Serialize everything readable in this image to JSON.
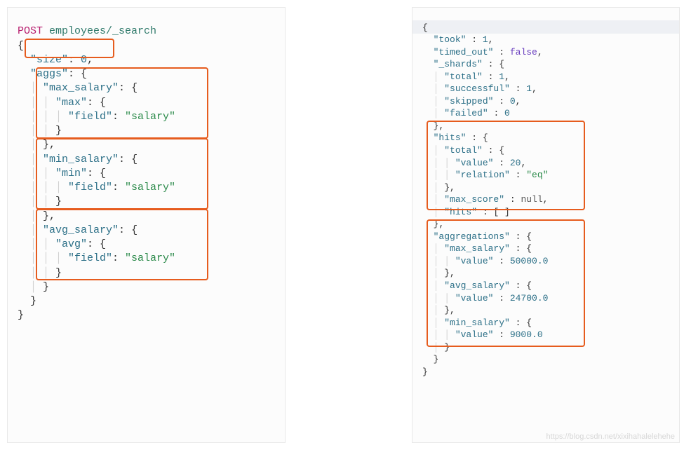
{
  "request": {
    "method": "POST",
    "path": "employees/_search",
    "size_key": "\"size\"",
    "size_val": "0",
    "aggs_key": "\"aggs\"",
    "max_salary_key": "\"max_salary\"",
    "max_key": "\"max\"",
    "min_salary_key": "\"min_salary\"",
    "min_key": "\"min\"",
    "avg_salary_key": "\"avg_salary\"",
    "avg_key": "\"avg\"",
    "field_key": "\"field\"",
    "field_val": "\"salary\""
  },
  "response": {
    "took_key": "\"took\"",
    "took_val": "1",
    "timed_out_key": "\"timed_out\"",
    "timed_out_val": "false",
    "shards_key": "\"_shards\"",
    "total_key": "\"total\"",
    "shards_total_val": "1",
    "successful_key": "\"successful\"",
    "successful_val": "1",
    "skipped_key": "\"skipped\"",
    "skipped_val": "0",
    "failed_key": "\"failed\"",
    "failed_val": "0",
    "hits_key": "\"hits\"",
    "hits_total_key": "\"total\"",
    "value_key": "\"value\"",
    "hits_total_value": "20",
    "relation_key": "\"relation\"",
    "relation_val": "\"eq\"",
    "max_score_key": "\"max_score\"",
    "max_score_val": "null",
    "hits_arr_key": "\"hits\"",
    "hits_arr_val": "[ ]",
    "aggregations_key": "\"aggregations\"",
    "max_salary_key": "\"max_salary\"",
    "max_salary_val": "50000.0",
    "avg_salary_key": "\"avg_salary\"",
    "avg_salary_val": "24700.0",
    "min_salary_key": "\"min_salary\"",
    "min_salary_val": "9000.0"
  },
  "watermark": "https://blog.csdn.net/xixihahalelehehe"
}
